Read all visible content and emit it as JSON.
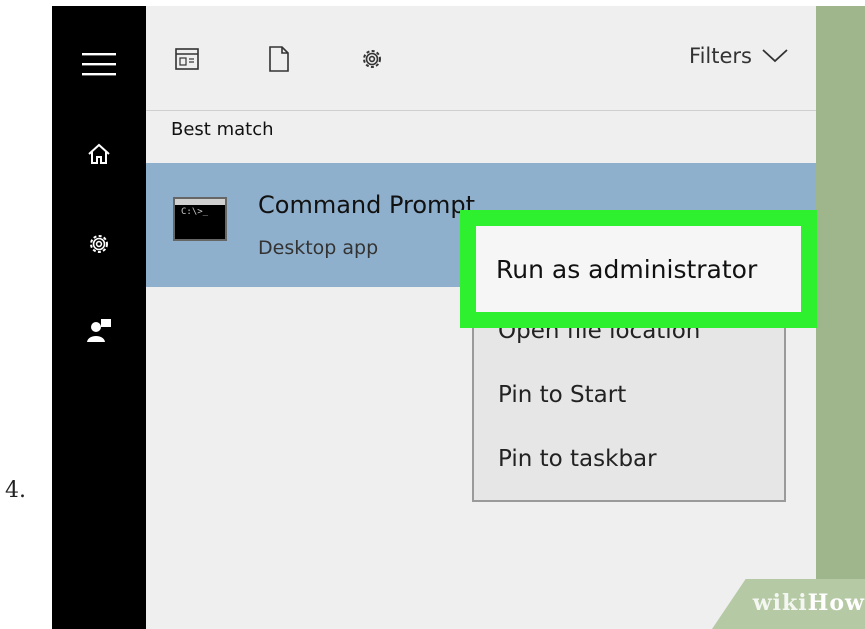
{
  "step_number": "4.",
  "topbar": {
    "filters_label": "Filters"
  },
  "section": {
    "heading": "Best match"
  },
  "result": {
    "title": "Command Prompt",
    "subtitle": "Desktop app",
    "icon_text": "C:\\>_"
  },
  "context_menu": {
    "highlighted": "Run as administrator",
    "items": [
      "Open file location",
      "Pin to Start",
      "Pin to taskbar"
    ]
  },
  "watermark": {
    "part1": "wiki",
    "part2": "How"
  },
  "colors": {
    "sidebar": "#000000",
    "panel": "#efefef",
    "selected_row": "#8fb0cc",
    "highlight_box": "#2ef02e",
    "menu": "#e6e6e6",
    "background_strip": "#9fb58c"
  },
  "icons": {
    "sidebar": [
      "hamburger-menu-icon",
      "home-icon",
      "gear-icon",
      "user-feedback-icon"
    ],
    "topbar": [
      "apps-view-icon",
      "document-icon",
      "gear-icon",
      "chevron-down-icon"
    ]
  }
}
